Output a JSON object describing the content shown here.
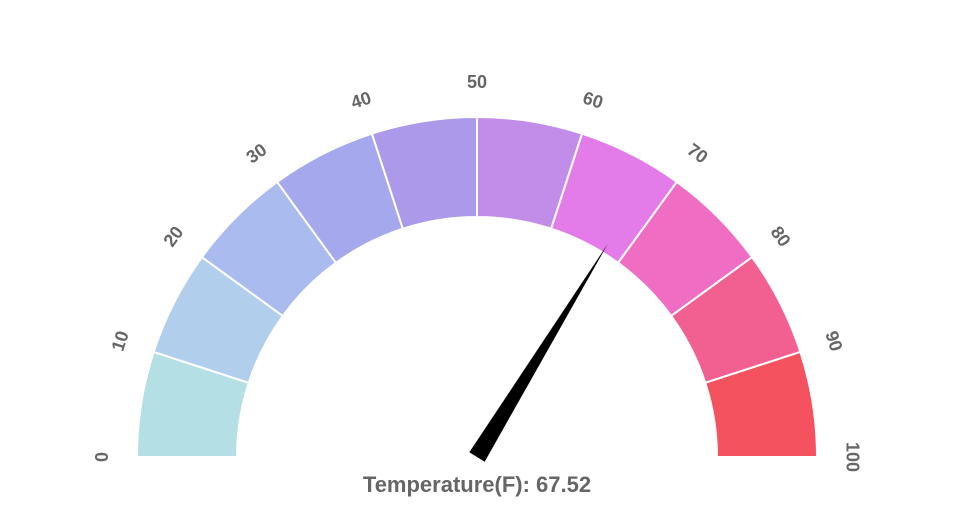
{
  "chart_data": {
    "type": "gauge",
    "min": 0,
    "max": 100,
    "value": 67.52,
    "label_prefix": "Temperature(F): ",
    "ticks": [
      0,
      10,
      20,
      30,
      40,
      50,
      60,
      70,
      80,
      90,
      100
    ],
    "segments": [
      {
        "from": 0,
        "to": 10,
        "color": "#b4dfe5"
      },
      {
        "from": 10,
        "to": 20,
        "color": "#b1cfed"
      },
      {
        "from": 20,
        "to": 30,
        "color": "#a9bbef"
      },
      {
        "from": 30,
        "to": 40,
        "color": "#a6a8ed"
      },
      {
        "from": 40,
        "to": 50,
        "color": "#ac99ea"
      },
      {
        "from": 50,
        "to": 60,
        "color": "#c28ce9"
      },
      {
        "from": 60,
        "to": 70,
        "color": "#e37ce8"
      },
      {
        "from": 70,
        "to": 80,
        "color": "#ef6dc3"
      },
      {
        "from": 80,
        "to": 90,
        "color": "#f25f91"
      },
      {
        "from": 90,
        "to": 100,
        "color": "#f3525e"
      }
    ],
    "needle_color": "#000000"
  }
}
